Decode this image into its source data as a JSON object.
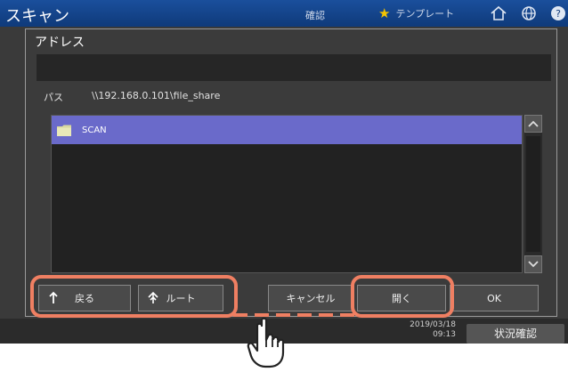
{
  "header": {
    "app_title": "スキャン",
    "confirm_tab": "確認",
    "template_tab": "テンプレート",
    "icons": [
      "home-icon",
      "globe-icon",
      "help-icon"
    ]
  },
  "dialog": {
    "title": "アドレス",
    "address_value": "",
    "path_label": "パス",
    "path_value": "\\\\192.168.0.101\\file_share",
    "files": [
      {
        "name": "SCAN",
        "icon": "folder-icon",
        "selected": true
      }
    ]
  },
  "buttons": {
    "back": "戻る",
    "root": "ルート",
    "cancel": "キャンセル",
    "open": "開く",
    "ok": "OK"
  },
  "status": {
    "date": "2019/03/18",
    "time": "09:13",
    "status_button": "状況確認"
  },
  "colors": {
    "header_blue": "#1a4f9c",
    "selection": "#6a6aca",
    "highlight": "#ef7f62",
    "star": "#f5c400"
  }
}
